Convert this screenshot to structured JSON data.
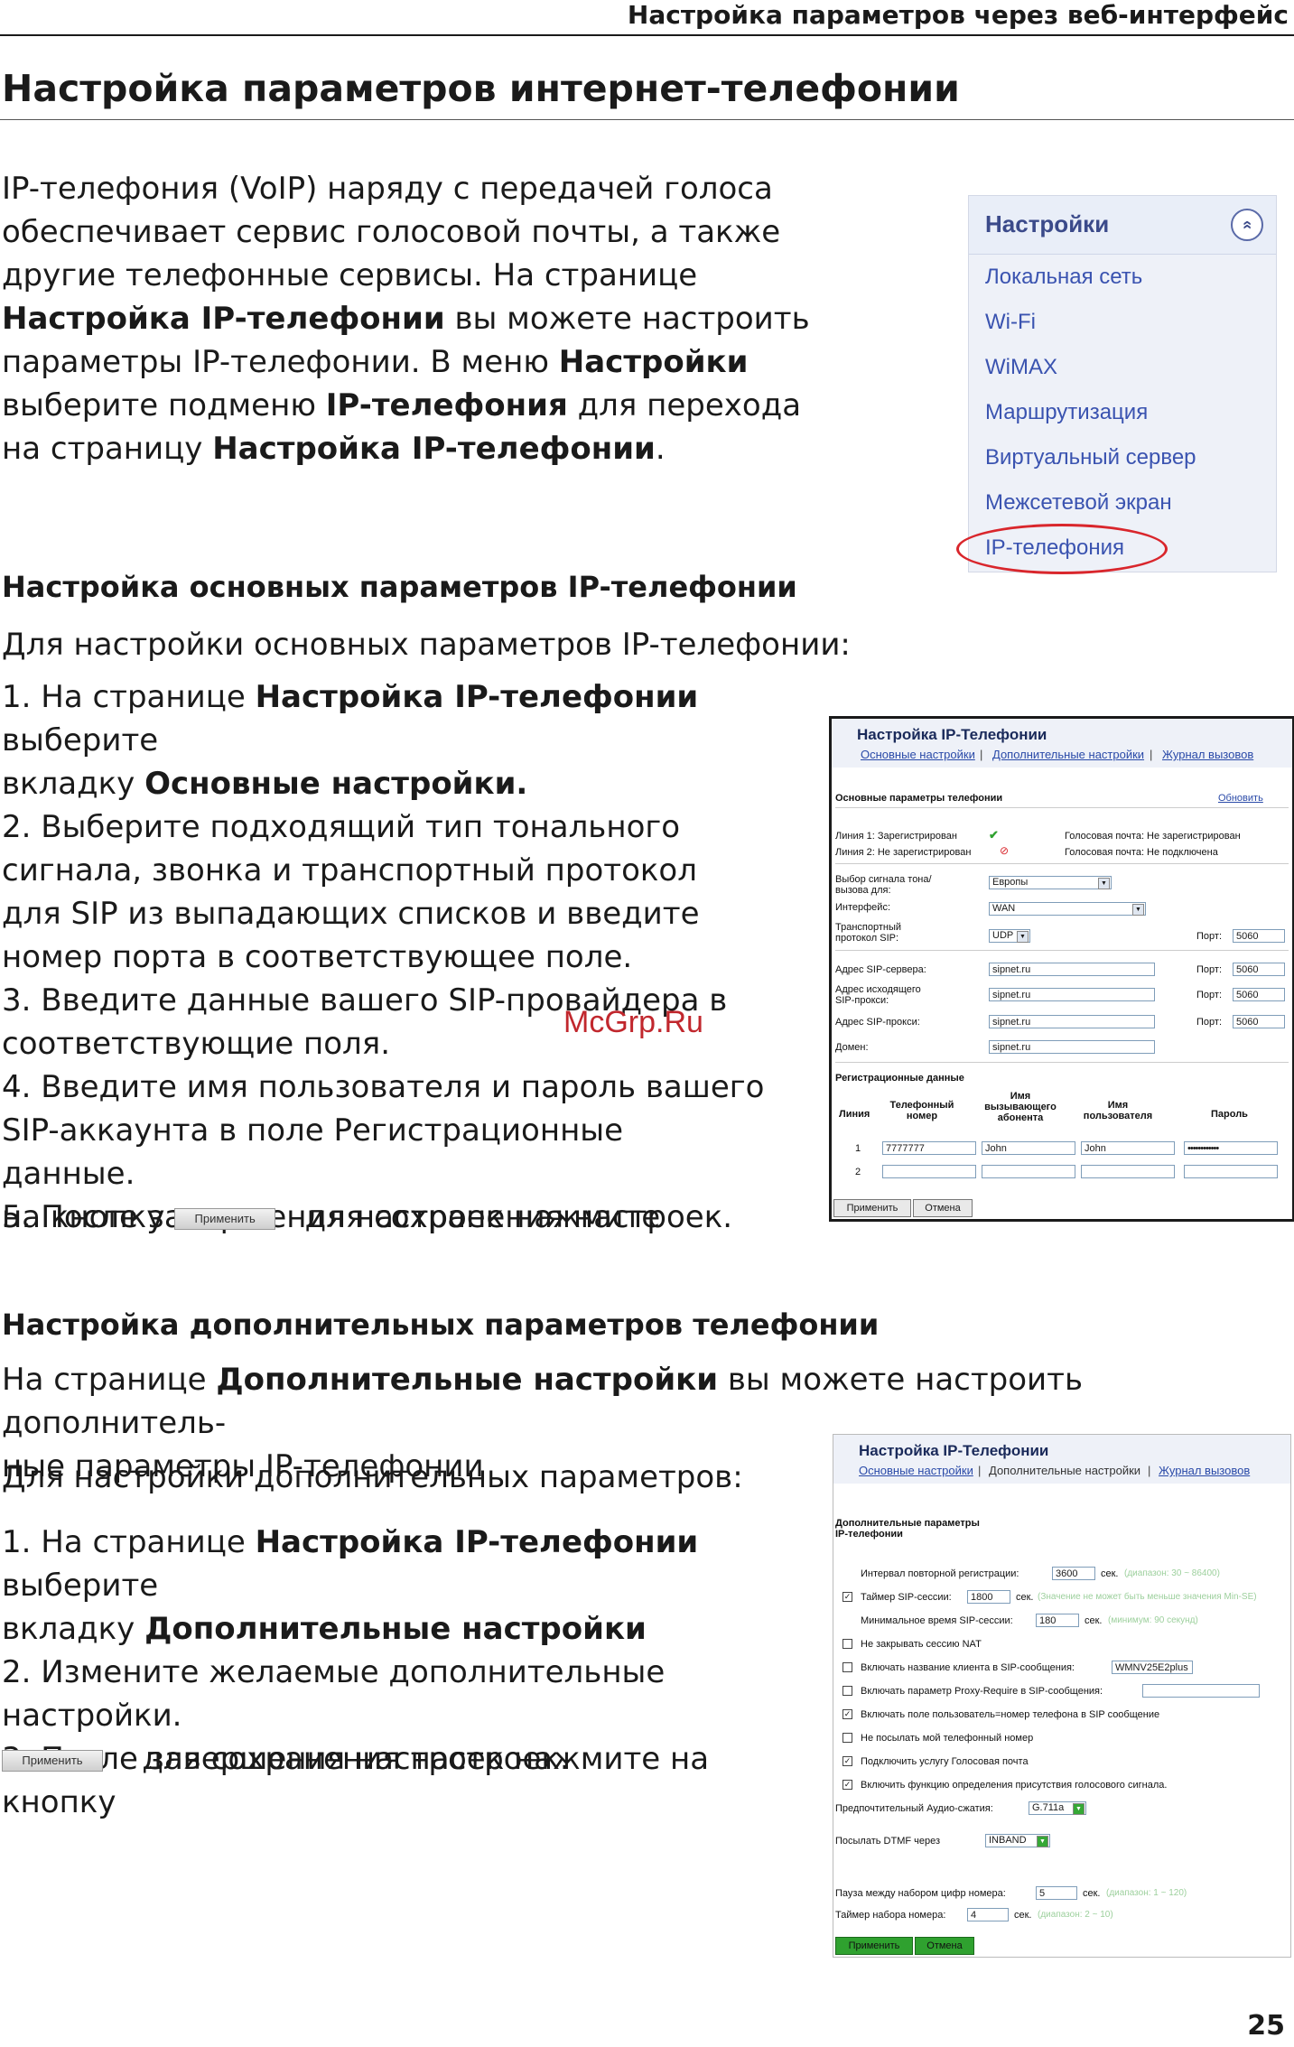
{
  "header": {
    "running_title": "Настройка параметров через веб-интерфейс",
    "page_title": "Настройка параметров интернет-телефонии",
    "page_number": "25"
  },
  "watermark": "McGrp.Ru",
  "intro": {
    "lines": [
      [
        "IP-телефония (VoIP) наряду с передачей голоса"
      ],
      [
        "обеспечивает сервис голосовой почты, а также"
      ],
      [
        "другие телефонные сервисы. На странице"
      ],
      [
        "Настройка IP-телефонии",
        " вы можете настроить"
      ],
      [
        "параметры IP-телефонии. В меню ",
        "Настройки"
      ],
      [
        "выберите подменю ",
        "IP-телефония",
        " для перехода"
      ],
      [
        "на страницу ",
        "Настройка IP-телефонии",
        "."
      ]
    ]
  },
  "settings_menu": {
    "title": "Настройки",
    "collapse_glyph": "«",
    "items": [
      "Локальная сеть",
      "Wi-Fi",
      "WiMAX",
      "Маршрутизация",
      "Виртуальный сервер",
      "Межсетевой экран",
      "IP-телефония"
    ]
  },
  "basic": {
    "heading": "Настройка основных параметров IP-телефонии",
    "lead": "Для настройки основных параметров IP-телефонии:",
    "steps": [
      [
        "1. На странице ",
        "Настройка IP-телефонии",
        " выберите"
      ],
      [
        "вкладку ",
        "Основные настройки."
      ],
      [
        "2. Выберите подходящий тип тонального"
      ],
      [
        "сигнала, звонка и транспортный протокол"
      ],
      [
        "для SIP из выпадающих списков и введите"
      ],
      [
        "номер порта в соответствующее поле."
      ],
      [
        "3. Введите данные вашего SIP-провайдера в"
      ],
      [
        "соответствующие поля."
      ],
      [
        "4. Введите имя пользователя и пароль вашего"
      ],
      [
        "SIP-аккаунта в поле Регистрационные"
      ],
      [
        "данные."
      ],
      [
        "5. После завершения настроек нажмите"
      ]
    ],
    "last_line_pre": "на кнопку",
    "last_line_post": "для сохранения настроек.",
    "apply_label": "Применить"
  },
  "advanced": {
    "heading": "Настройка дополнительных параметров телефонии",
    "lead_lines": [
      [
        "На странице ",
        "Дополнительные настройки",
        " вы можете настроить дополнитель-"
      ],
      [
        "ные параметры IP-телефонии"
      ]
    ],
    "lead2": "Для настройки дополнительных параметров:",
    "steps": [
      [
        "1. На странице ",
        "Настройка IP-телефонии",
        " выберите"
      ],
      [
        "вкладку ",
        "Дополнительные настройки"
      ],
      [
        "2. Измените желаемые дополнительные"
      ],
      [
        "настройки."
      ],
      [
        "3. После завершения настроек нажмите на кнопку"
      ]
    ],
    "last_line_post": "для сохранения настроек.",
    "apply_label": "Применить"
  },
  "shot1": {
    "title": "Настройка IP-Телефонии",
    "tabs": [
      "Основные настройки",
      "Дополнительные настройки",
      "Журнал вызовов"
    ],
    "section": "Основные параметры телефонии",
    "refresh": "Обновить",
    "line1": "Линия 1: Зарегистрирован",
    "line2": "Линия 2: Не зарегистрирован",
    "vm1": "Голосовая почта: Не зарегистрирован",
    "vm2": "Голосовая почта: Не подключена",
    "tone_label": "Выбор сигнала тона/вызова для:",
    "tone_value": "Европы",
    "iface_label": "Интерфейс:",
    "iface_value": "WAN",
    "transport_label": "Транспортный протокол SIP:",
    "transport_value": "UDP",
    "port_label": "Порт:",
    "port_value": "5060",
    "server_label": "Адрес SIP-сервера:",
    "outproxy_label": "Адрес исходящего SIP-прокси:",
    "proxy_label": "Адрес SIP-прокси:",
    "domain_label": "Домен:",
    "sip_value": "sipnet.ru",
    "reg_section": "Регистрационные данные",
    "cols": [
      "Линия",
      "Телефонный номер",
      "Имя вызывающего абонента",
      "Имя пользователя",
      "Пароль"
    ],
    "row1": [
      "1",
      "7777777",
      "John",
      "John",
      "••••••••••••"
    ],
    "row2_num": "2",
    "apply": "Применить",
    "cancel": "Отмена"
  },
  "shot2": {
    "title": "Настройка IP-Телефонии",
    "tabs": [
      "Основные настройки",
      "Дополнительные настройки",
      "Журнал вызовов"
    ],
    "section": "Дополнительные параметры IP-телефонии",
    "rereg_label": "Интервал повторной регистрации:",
    "rereg_value": "3600",
    "rereg_unit": "сек.",
    "rereg_hint": "(диапазон: 30 ~ 86400)",
    "timer_label": "Таймер SIP-сессии:",
    "timer_value": "1800",
    "timer_unit": "сек.",
    "timer_hint": "(Значение не может быть меньше значения Min-SE)",
    "min_label": "Минимальное время SIP-сессии:",
    "min_value": "180",
    "min_unit": "сек.",
    "min_hint": "(минимум: 90 секунд)",
    "nat_label": "Не закрывать сессию NAT",
    "client_label": "Включать название клиента в SIP-сообщения:",
    "client_value": "WMNV25E2plus",
    "proxyreq_label": "Включать параметр Proxy-Require в SIP-сообщения:",
    "userphone_label": "Включать поле пользователь=номер телефона в SIP сообщение",
    "hide_label": "Не посылать мой телефонный номер",
    "voicemail_label": "Подключить услугу Голосовая почта",
    "vad_label": "Включить функцию определения присутствия голосового сигнала.",
    "codec_label": "Предпочтительный Аудио-сжатия:",
    "codec_value": "G.711a",
    "dtmf_label": "Посылать DTMF через",
    "dtmf_value": "INBAND",
    "pause_label": "Пауза между набором цифр номера:",
    "pause_value": "5",
    "pause_unit": "сек.",
    "pause_hint": "(диапазон: 1 ~ 120)",
    "dial_label": "Таймер набора номера:",
    "dial_value": "4",
    "dial_unit": "сек.",
    "dial_hint": "(диапазон: 2 ~ 10)",
    "apply": "Применить",
    "cancel": "Отмена"
  }
}
